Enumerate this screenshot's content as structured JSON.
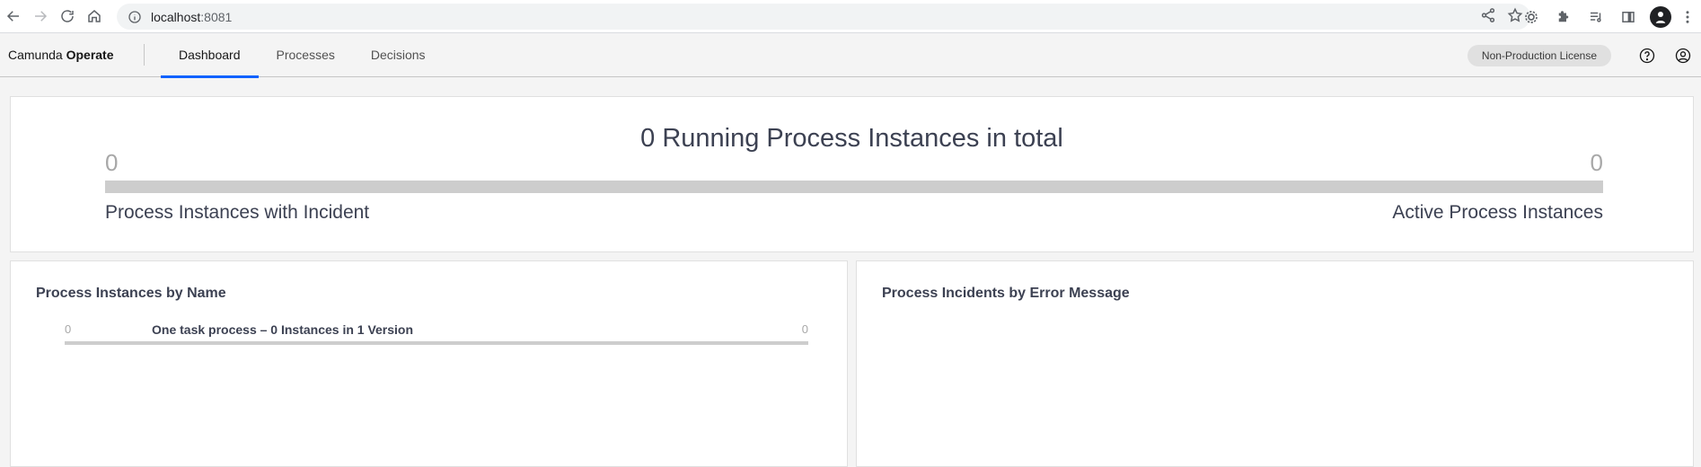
{
  "browser": {
    "url_host": "localhost",
    "url_port": ":8081"
  },
  "app": {
    "brand_name": "Camunda",
    "brand_product": "Operate",
    "tabs": [
      {
        "label": "Dashboard",
        "active": true
      },
      {
        "label": "Processes",
        "active": false
      },
      {
        "label": "Decisions",
        "active": false
      }
    ],
    "license_badge": "Non-Production License"
  },
  "summary": {
    "title": "0 Running Process Instances in total",
    "incident_count": "0",
    "active_count": "0",
    "incident_label": "Process Instances with Incident",
    "active_label": "Active Process Instances"
  },
  "by_name": {
    "title": "Process Instances by Name",
    "rows": [
      {
        "incident_count": "0",
        "name": "One task process – 0 Instances in 1 Version",
        "active_count": "0"
      }
    ]
  },
  "by_error": {
    "title": "Process Incidents by Error Message"
  },
  "colors": {
    "accent": "#0f62fe",
    "bar": "#cdcdcd",
    "text": "#3c4152",
    "muted": "#a8a8a8"
  }
}
